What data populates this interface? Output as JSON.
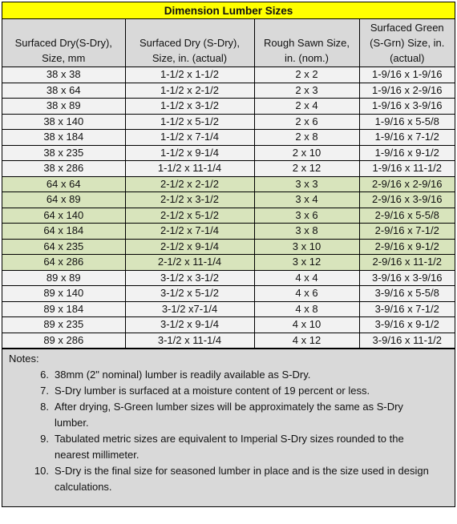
{
  "title": "Dimension Lumber Sizes",
  "columns": [
    {
      "line1": "Surfaced Dry(S-Dry),",
      "line2": "Size, mm",
      "line3": ""
    },
    {
      "line1": "Surfaced Dry (S-Dry),",
      "line2": "Size, in. (actual)",
      "line3": ""
    },
    {
      "line1": "Rough Sawn Size,",
      "line2": "in. (nom.)",
      "line3": ""
    },
    {
      "line1": "Surfaced Green",
      "line2": "(S-Grn) Size, in.",
      "line3": "(actual)"
    }
  ],
  "colors": {
    "title_bg": "#FFFF00",
    "header_bg": "#D9D9D9",
    "plain_row_bg": "#F2F2F2",
    "green_row_bg": "#D8E4BC",
    "notes_bg": "#D9D9D9"
  },
  "rows": [
    {
      "mm": "38 x 38",
      "sdry": "1-1/2 x 1-1/2",
      "rough": "2 x 2",
      "sgrn": "1-9/16 x 1-9/16",
      "band": "plain"
    },
    {
      "mm": "38 x 64",
      "sdry": "1-1/2 x 2-1/2",
      "rough": "2 x 3",
      "sgrn": "1-9/16 x 2-9/16",
      "band": "plain"
    },
    {
      "mm": "38 x 89",
      "sdry": "1-1/2 x 3-1/2",
      "rough": "2 x 4",
      "sgrn": "1-9/16 x 3-9/16",
      "band": "plain"
    },
    {
      "mm": "38 x 140",
      "sdry": "1-1/2 x 5-1/2",
      "rough": "2 x 6",
      "sgrn": "1-9/16 x 5-5/8",
      "band": "plain"
    },
    {
      "mm": "38 x 184",
      "sdry": "1-1/2 x 7-1/4",
      "rough": "2 x 8",
      "sgrn": "1-9/16 x 7-1/2",
      "band": "plain"
    },
    {
      "mm": "38 x 235",
      "sdry": "1-1/2 x 9-1/4",
      "rough": "2 x 10",
      "sgrn": "1-9/16 x 9-1/2",
      "band": "plain"
    },
    {
      "mm": "38 x 286",
      "sdry": "1-1/2 x 11-1/4",
      "rough": "2 x 12",
      "sgrn": "1-9/16 x 11-1/2",
      "band": "plain"
    },
    {
      "mm": "64 x 64",
      "sdry": "2-1/2 x 2-1/2",
      "rough": "3 x 3",
      "sgrn": "2-9/16 x 2-9/16",
      "band": "green"
    },
    {
      "mm": "64 x 89",
      "sdry": "2-1/2 x 3-1/2",
      "rough": "3 x 4",
      "sgrn": "2-9/16 x 3-9/16",
      "band": "green"
    },
    {
      "mm": "64 x 140",
      "sdry": "2-1/2 x 5-1/2",
      "rough": "3 x 6",
      "sgrn": "2-9/16 x 5-5/8",
      "band": "green"
    },
    {
      "mm": "64 x 184",
      "sdry": "2-1/2 x 7-1/4",
      "rough": "3 x 8",
      "sgrn": "2-9/16 x 7-1/2",
      "band": "green"
    },
    {
      "mm": "64 x 235",
      "sdry": "2-1/2 x 9-1/4",
      "rough": "3 x 10",
      "sgrn": "2-9/16 x 9-1/2",
      "band": "green"
    },
    {
      "mm": "64 x 286",
      "sdry": "2-1/2 x 11-1/4",
      "rough": "3 x 12",
      "sgrn": "2-9/16 x 11-1/2",
      "band": "green"
    },
    {
      "mm": "89 x 89",
      "sdry": "3-1/2 x 3-1/2",
      "rough": "4 x 4",
      "sgrn": "3-9/16 x 3-9/16",
      "band": "plain"
    },
    {
      "mm": "89 x 140",
      "sdry": "3-1/2 x 5-1/2",
      "rough": "4 x 6",
      "sgrn": "3-9/16 x 5-5/8",
      "band": "plain"
    },
    {
      "mm": "89 x 184",
      "sdry": "3-1/2 x7-1/4",
      "rough": "4 x 8",
      "sgrn": "3-9/16 x 7-1/2",
      "band": "plain"
    },
    {
      "mm": "89 x 235",
      "sdry": "3-1/2 x 9-1/4",
      "rough": "4 x 10",
      "sgrn": "3-9/16 x 9-1/2",
      "band": "plain"
    },
    {
      "mm": "89 x 286",
      "sdry": "3-1/2 x 11-1/4",
      "rough": "4 x 12",
      "sgrn": "3-9/16 x 11-1/2",
      "band": "plain"
    }
  ],
  "notes": {
    "label": "Notes:",
    "items": [
      {
        "num": "6.",
        "text": "38mm (2\" nominal) lumber is readily available as S-Dry."
      },
      {
        "num": "7.",
        "text": "S-Dry lumber is surfaced at a moisture content of 19 percent or less."
      },
      {
        "num": "8.",
        "text": "After drying, S-Green lumber sizes will be approximately the same as S-Dry lumber."
      },
      {
        "num": "9.",
        "text": "Tabulated metric sizes are equivalent to Imperial S-Dry sizes rounded to the nearest millimeter."
      },
      {
        "num": "10.",
        "text": "S-Dry is the final size for seasoned lumber in place and is the size used in design calculations."
      }
    ]
  }
}
